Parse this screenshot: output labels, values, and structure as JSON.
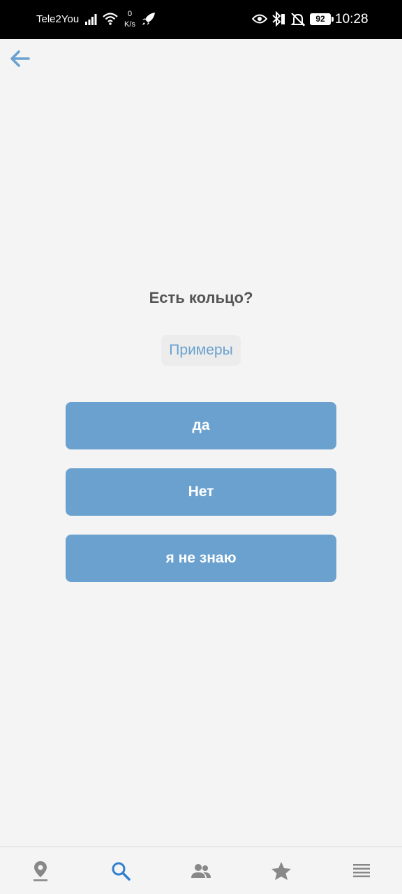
{
  "status_bar": {
    "carrier": "Tele2You",
    "speed_value": "0",
    "speed_unit": "K/s",
    "battery": "92",
    "time": "10:28"
  },
  "question": {
    "text": "Есть кольцо?"
  },
  "examples_button": {
    "label": "Примеры"
  },
  "answers": [
    {
      "label": "да"
    },
    {
      "label": "Нет"
    },
    {
      "label": "я не знаю"
    }
  ],
  "bottom_nav": {
    "items": [
      {
        "icon": "location-pin-icon",
        "active": false
      },
      {
        "icon": "search-icon",
        "active": true
      },
      {
        "icon": "people-icon",
        "active": false
      },
      {
        "icon": "star-icon",
        "active": false
      },
      {
        "icon": "menu-list-icon",
        "active": false
      }
    ]
  },
  "colors": {
    "accent": "#6aa1cf",
    "active_nav": "#2f7fd0",
    "inactive_nav": "#888888",
    "question_text": "#555555",
    "background": "#f4f4f4"
  }
}
